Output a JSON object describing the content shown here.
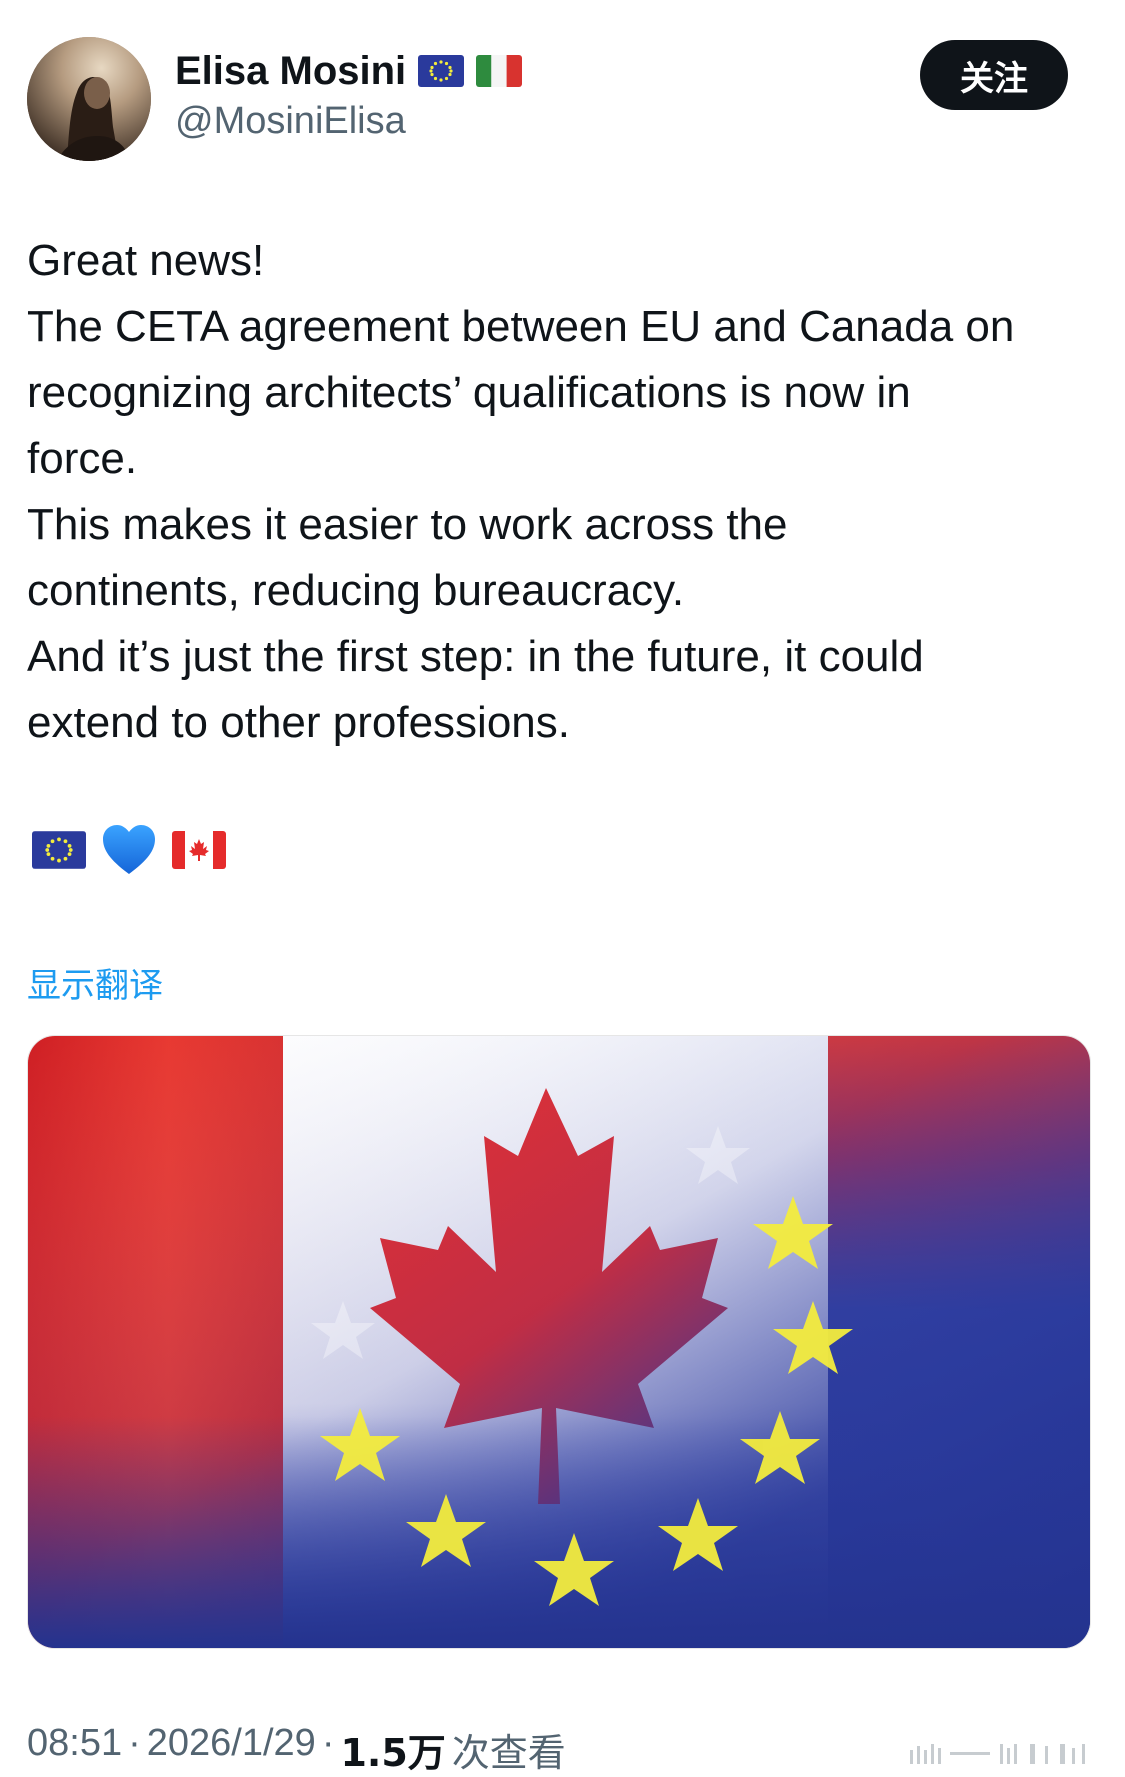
{
  "author": {
    "display_name": "Elisa Mosini",
    "handle": "@MosiniElisa",
    "name_badges": [
      "eu-flag-icon",
      "italy-flag-icon"
    ]
  },
  "follow_button": {
    "label": "关注"
  },
  "tweet": {
    "lines": [
      "Great news!",
      "The CETA agreement between EU and Canada on",
      "recognizing architects’ qualifications is now in",
      "force.",
      "This makes it easier to work across the",
      "continents, reducing bureaucracy.",
      "And it’s just the first step: in the future, it could",
      "extend to other professions."
    ],
    "emojis": [
      "eu-flag-icon",
      "blue-heart-icon",
      "canada-flag-icon"
    ],
    "translate_label": "显示翻译"
  },
  "media": {
    "image": "canada-eu-blended-flag-image"
  },
  "meta": {
    "time": "08:51",
    "separator": "·",
    "date": "2026/1/29",
    "views_count": "1.5万",
    "views_label": "次查看"
  },
  "colors": {
    "text_primary": "#0f1419",
    "text_secondary": "#536471",
    "link": "#1d9bf0",
    "button_bg": "#0f1419",
    "canada_red": "#e52b2b",
    "eu_blue": "#2a3a9c",
    "eu_star": "#f3ec3d"
  }
}
